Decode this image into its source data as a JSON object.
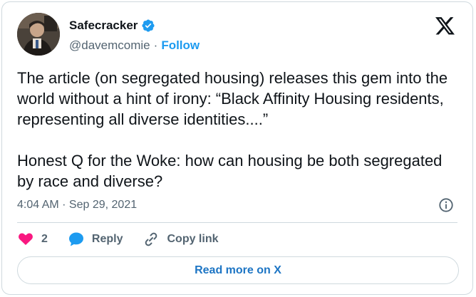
{
  "author": {
    "name": "Safecracker",
    "handle": "@davemcomie",
    "separator": "·",
    "follow_label": "Follow"
  },
  "tweet": {
    "text": "The article (on segregated housing) releases this gem into the world without a hint of irony: “Black Affinity Housing residents, representing all diverse identities....”\n\nHonest Q for the Woke: how can housing be both segregated by race and diverse?",
    "timestamp": "4:04 AM · Sep 29, 2021"
  },
  "actions": {
    "like_count": "2",
    "reply_label": "Reply",
    "copy_link_label": "Copy link"
  },
  "read_more_label": "Read more on X",
  "colors": {
    "accent": "#1d9bf0",
    "like": "#f91880",
    "text": "#0f1419",
    "secondary": "#536471",
    "border": "#cfd9de"
  },
  "icons": [
    "verified-badge-icon",
    "x-logo-icon",
    "info-icon",
    "heart-icon",
    "reply-bubble-icon",
    "link-icon"
  ]
}
